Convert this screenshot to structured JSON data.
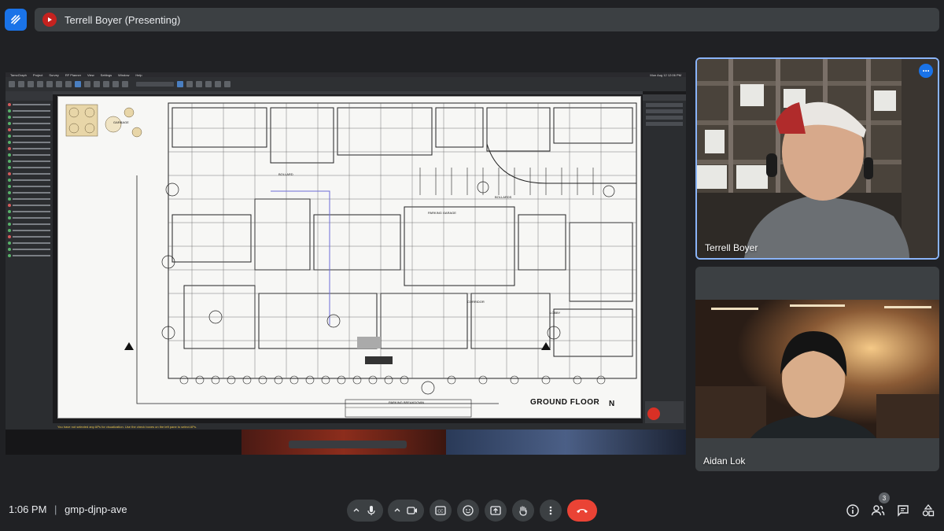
{
  "header": {
    "presenter_label": "Terrell Boyer (Presenting)"
  },
  "participants": [
    {
      "name": "Terrell Boyer"
    },
    {
      "name": "Aidan Lok"
    }
  ],
  "meeting": {
    "time": "1:06 PM",
    "separator": "|",
    "code": "gmp-djnp-ave",
    "people_count": "3"
  },
  "shared_screen": {
    "menubar_app": "TamoGraph",
    "menubar_items": [
      "Project",
      "Survey",
      "RF Planner",
      "View",
      "Settings",
      "Window",
      "Help"
    ],
    "menubar_clock": "Mon Aug 12  12:06 PM",
    "floor_plan_title": "GROUND FLOOR",
    "north_label": "N",
    "labels": [
      "BOLLARD",
      "BOLLARDS",
      "PARKING GARAGE",
      "CORRIDOR",
      "LOBBY",
      "GARBAGE",
      "PARKING BREAKDOWN"
    ],
    "warning_text": "You have not selected any APs for visualization. Use the check boxes on the left pane to select APs."
  },
  "icons": {
    "app_logo": "meet-companion-icon",
    "presenting": "present-icon",
    "more": "more-options-icon",
    "mic": "microphone-icon",
    "camera": "camera-icon",
    "captions": "captions-icon",
    "emoji": "emoji-icon",
    "present_now": "present-now-icon",
    "raise_hand": "raise-hand-icon",
    "more_options": "more-vert-icon",
    "end_call": "end-call-icon",
    "info": "info-icon",
    "people": "people-icon",
    "chat": "chat-icon",
    "activities": "activities-icon"
  },
  "colors": {
    "background": "#202124",
    "accent": "#1a73e8",
    "active_speaker_border": "#8ab4f8",
    "end_call": "#ea4335"
  }
}
